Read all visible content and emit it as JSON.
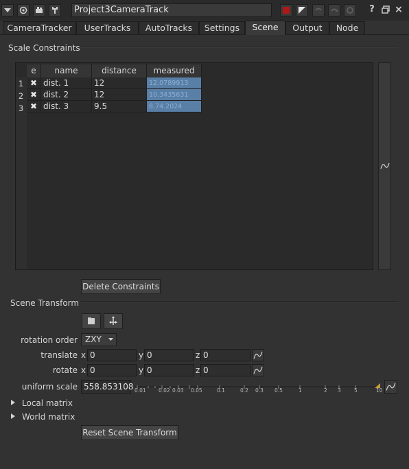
{
  "window": {
    "node_name": "Project3CameraTrack"
  },
  "tabs": [
    "CameraTracker",
    "UserTracks",
    "AutoTracks",
    "Settings",
    "Scene",
    "Output",
    "Node"
  ],
  "active_tab": "Scene",
  "scale_constraints": {
    "section_label": "Scale Constraints",
    "columns": [
      "e",
      "name",
      "distance",
      "measured"
    ],
    "rows": [
      {
        "num": "1",
        "enabled": "✖",
        "name": "dist. 1",
        "distance": "12",
        "measured": "12.0789913"
      },
      {
        "num": "2",
        "enabled": "✖",
        "name": "dist. 2",
        "distance": "12",
        "measured": "10.3435631"
      },
      {
        "num": "3",
        "enabled": "✖",
        "name": "dist. 3",
        "distance": "9.5",
        "measured": "8.74.2024"
      }
    ],
    "delete_button": "Delete Constraints"
  },
  "scene_transform": {
    "section_label": "Scene Transform",
    "rotation_order_label": "rotation order",
    "rotation_order_value": "ZXY",
    "translate_label": "translate",
    "rotate_label": "rotate",
    "axis_x": "x",
    "axis_y": "y",
    "axis_z": "z",
    "translate": {
      "x": "0",
      "y": "0",
      "z": "0"
    },
    "rotate": {
      "x": "0",
      "y": "0",
      "z": "0"
    },
    "uniform_scale_label": "uniform scale",
    "uniform_scale_value": "558.853108",
    "scale_ticks": [
      "0.01",
      "0.02",
      "0.03",
      "0.05",
      "0.1",
      "0.2",
      "0.3",
      "0.5",
      "1",
      "2",
      "3",
      "5",
      "10"
    ],
    "local_matrix": "Local matrix",
    "world_matrix": "World matrix",
    "reset_button": "Reset Scene Transform"
  },
  "colors": {
    "panel_bg": "#323232",
    "selected_cell": "#5a7fa6",
    "accent_red": "#b01818",
    "slider_handle": "#c89a3a"
  }
}
